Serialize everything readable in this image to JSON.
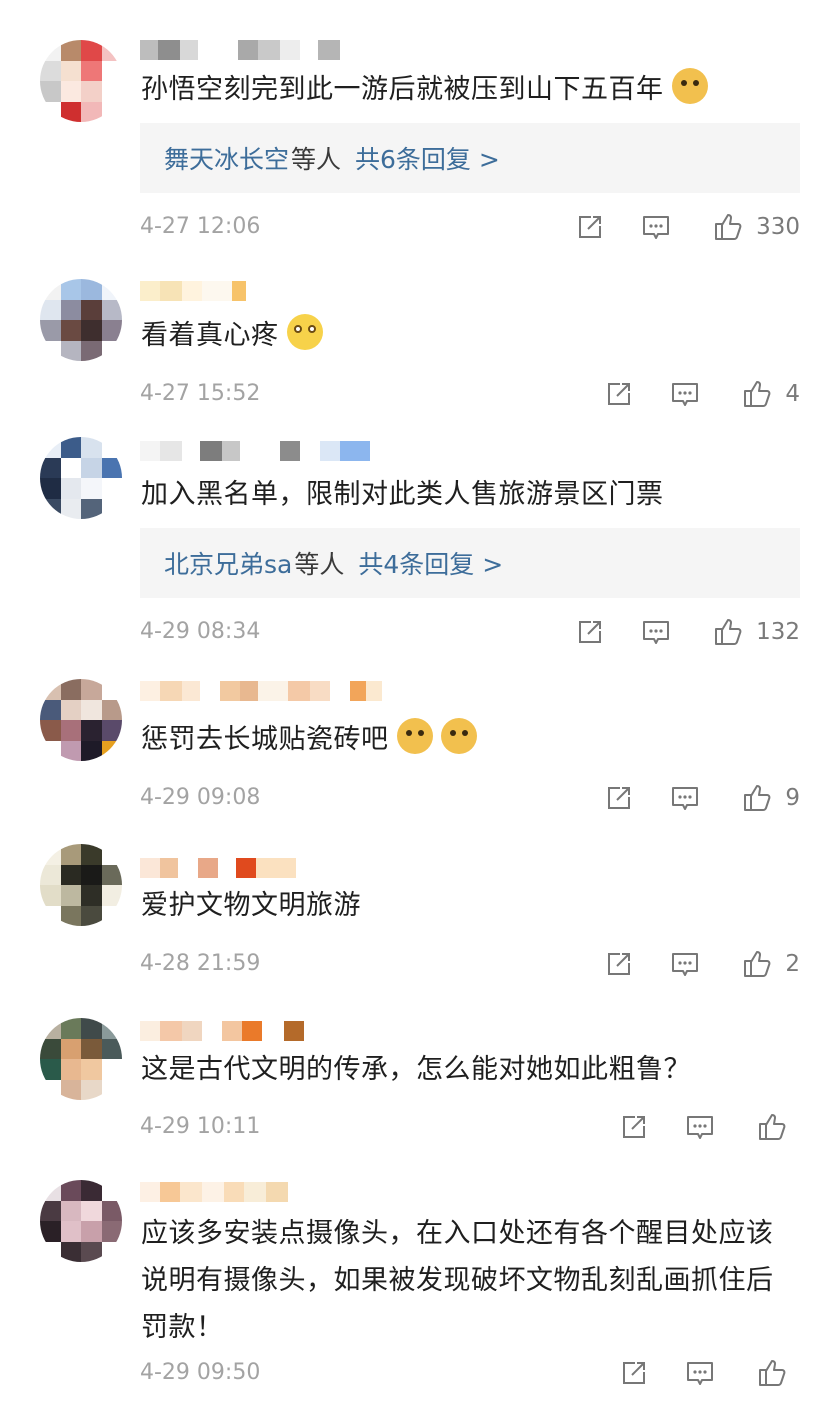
{
  "comments": [
    {
      "text": "孙悟空刻完到此一游后就被压到山下五百年",
      "emojis": [
        "doge-emoji"
      ],
      "reply_names": "舞天冰长空",
      "reply_mid": "等人",
      "reply_count": "共6条回复 >",
      "time": "4-27 12:06",
      "likes": "330"
    },
    {
      "text": "看着真心疼",
      "emojis": [
        "sad-emoji"
      ],
      "time": "4-27 15:52",
      "likes": "4"
    },
    {
      "text": "加入黑名单，限制对此类人售旅游景区门票",
      "emojis": [],
      "reply_names": "北京兄弟sa",
      "reply_mid": "等人",
      "reply_count": "共4条回复 >",
      "time": "4-29 08:34",
      "likes": "132"
    },
    {
      "text": "惩罚去长城贴瓷砖吧",
      "emojis": [
        "doge-emoji",
        "doge-emoji"
      ],
      "time": "4-29 09:08",
      "likes": "9"
    },
    {
      "text": "爱护文物文明旅游",
      "emojis": [],
      "time": "4-28 21:59",
      "likes": "2"
    },
    {
      "text": "这是古代文明的传承，怎么能对她如此粗鲁？",
      "emojis": [],
      "time": "4-29 10:11",
      "likes": ""
    },
    {
      "text": "应该多安装点摄像头，在入口处还有各个醒目处应该说明有摄像头，如果被发现破坏文物乱刻乱画抓住后罚款！",
      "emojis": [],
      "time": "4-29 09:50",
      "likes": ""
    }
  ],
  "colors": {
    "reply_link": "#3d6d9a",
    "timestamp": "#a3a3a3",
    "reply_bg": "#f5f5f5"
  },
  "icons": [
    "share-icon",
    "comment-icon",
    "thumbs-up-icon"
  ]
}
